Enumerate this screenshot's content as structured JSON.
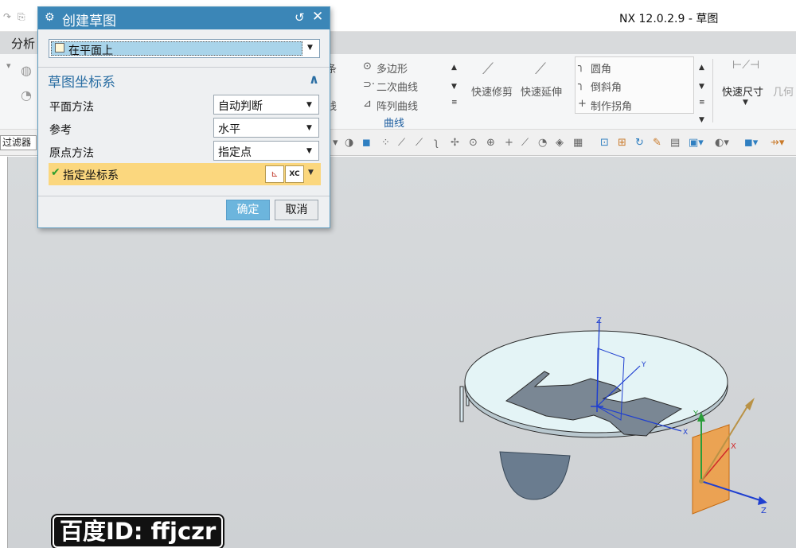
{
  "window": {
    "title": "NX 12.0.2.9 - 草图"
  },
  "menubar": {
    "analysis": "分析"
  },
  "ribbon": {
    "polygon": "多边形",
    "conic": "二次曲线",
    "pattern_curve": "阵列曲线",
    "quick_trim": "快速修剪",
    "quick_extend": "快速延伸",
    "fillet": "圆角",
    "chamfer": "倒斜角",
    "make_corner": "制作拐角",
    "quick_dimension": "快速尺寸",
    "geometry_partial": "几何",
    "curve_group": "曲线",
    "fragment_1": "条",
    "fragment_2": "线"
  },
  "toolbar": {
    "filter": "过滤器"
  },
  "dialog": {
    "title": "创建草图",
    "sketch_type": "在平面上",
    "group_title": "草图坐标系",
    "fields": [
      {
        "label": "平面方法",
        "value": "自动判断"
      },
      {
        "label": "参考",
        "value": "水平"
      },
      {
        "label": "原点方法",
        "value": "指定点"
      }
    ],
    "specify_csys": "指定坐标系",
    "ok": "确定",
    "cancel": "取消"
  },
  "scene": {
    "axis_z": "Z",
    "axis_y": "Y",
    "axis_x": "X",
    "csys_xc": "XC"
  },
  "watermark": {
    "text": "百度ID: ffjczr"
  },
  "colors": {
    "dialog_title": "#3b86b7",
    "highlight_row": "#fbd77e",
    "ok_button": "#6cb5dd",
    "disk": "#e4f4f6",
    "plane_orange": "#f09a3c"
  }
}
